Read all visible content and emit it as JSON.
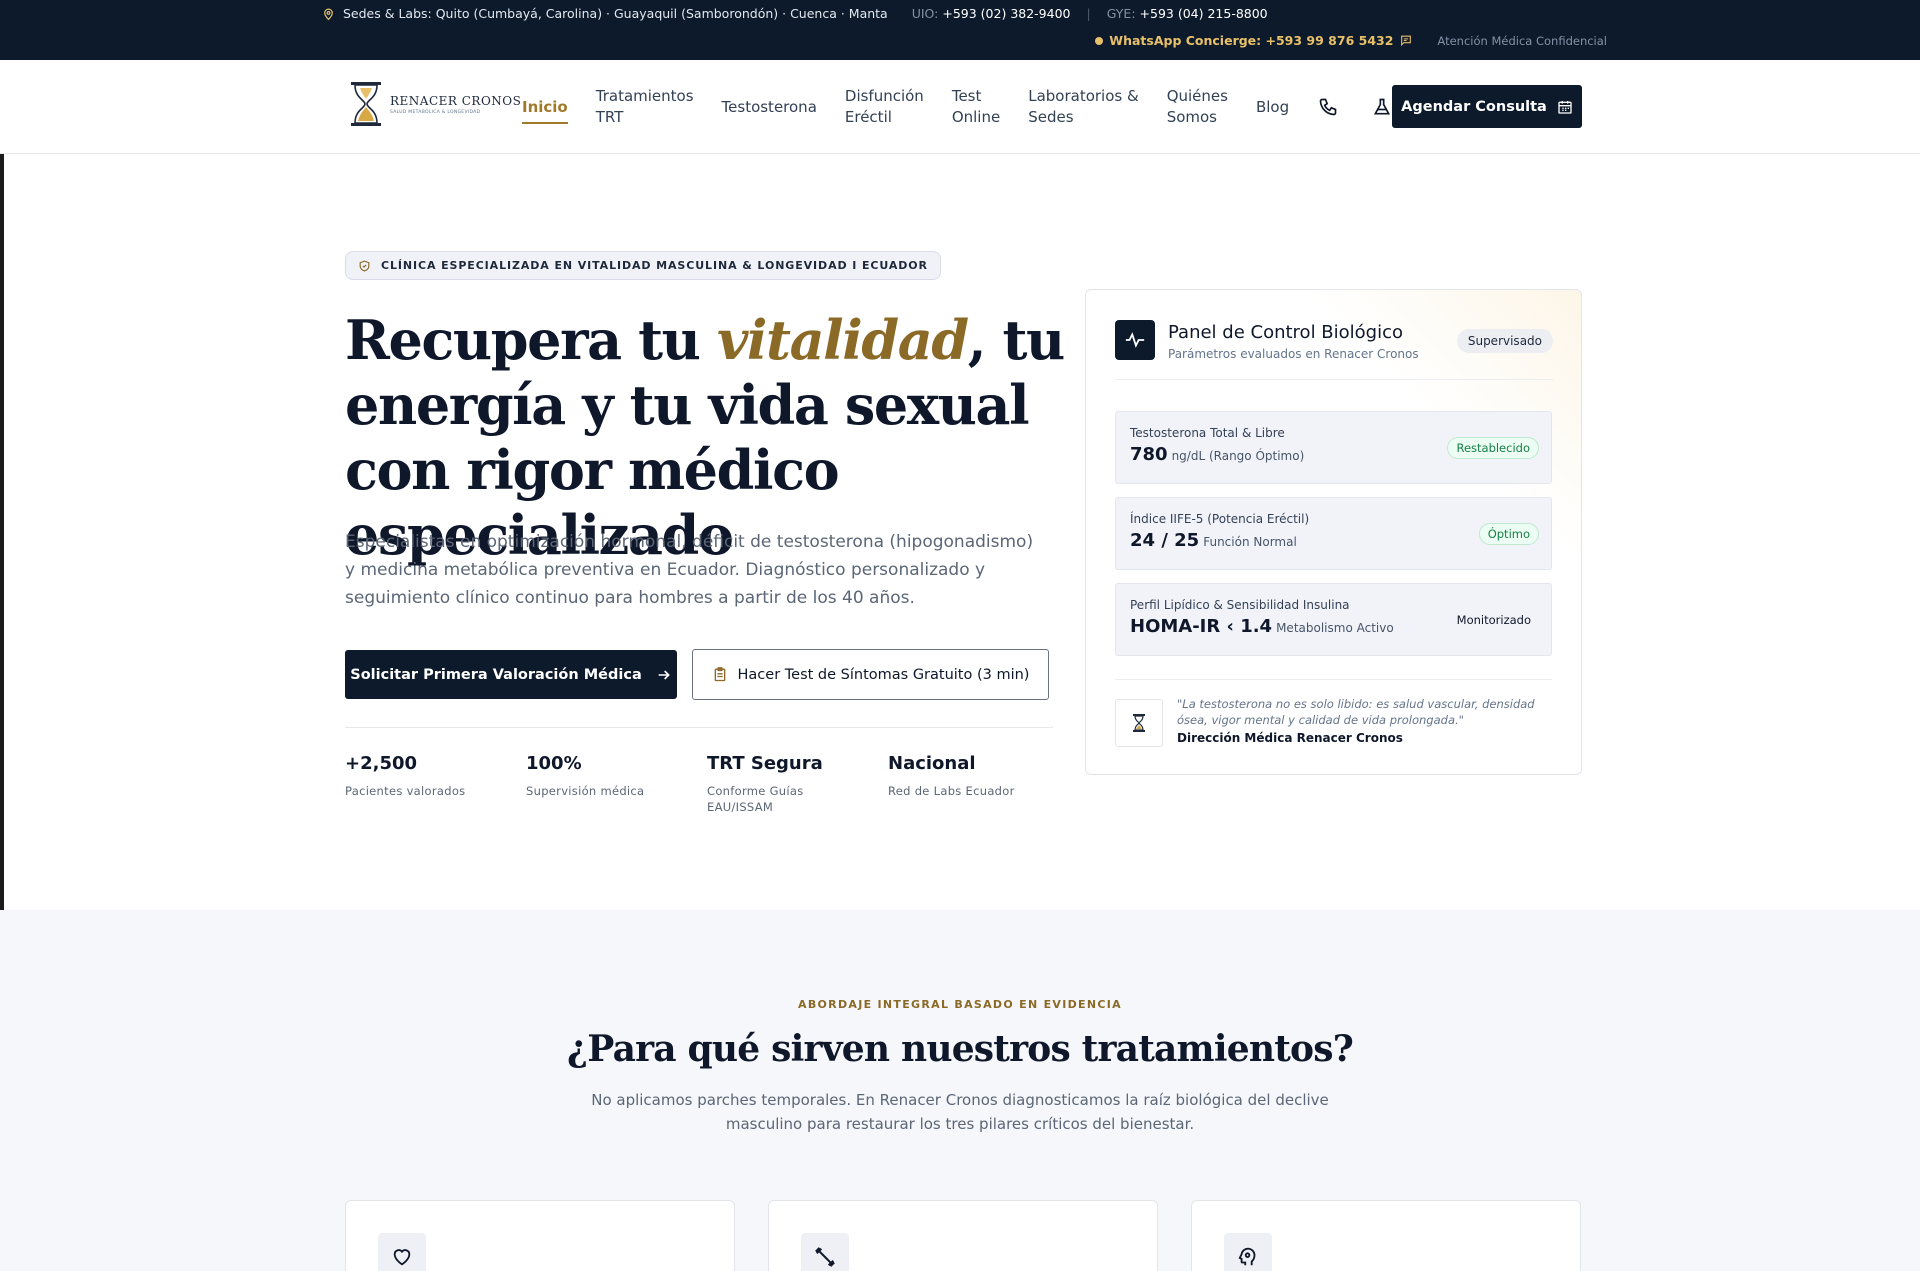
{
  "topbar": {
    "locations": "Sedes & Labs: Quito (Cumbayá, Carolina) · Guayaquil (Samborondón) · Cuenca · Manta",
    "uio_label": "UIO:",
    "uio_phone": "+593 (02) 382-9400",
    "gye_label": "GYE:",
    "gye_phone": "+593 (04) 215-8800",
    "whatsapp": "WhatsApp Concierge: +593 99 876 5432",
    "confidential": "Atención Médica Confidencial"
  },
  "logo": {
    "name": "RENACER CRONOS",
    "tagline": "SALUD METABÓLICA & LONGEVIDAD"
  },
  "nav": {
    "items": [
      {
        "line1": "Inicio",
        "line2": ""
      },
      {
        "line1": "Tratamientos",
        "line2": "TRT"
      },
      {
        "line1": "Testosterona",
        "line2": ""
      },
      {
        "line1": "Disfunción",
        "line2": "Eréctil"
      },
      {
        "line1": "Test",
        "line2": "Online"
      },
      {
        "line1": "Laboratorios &",
        "line2": "Sedes"
      },
      {
        "line1": "Quiénes",
        "line2": "Somos"
      },
      {
        "line1": "Blog",
        "line2": ""
      }
    ],
    "cta": "Agendar Consulta"
  },
  "hero": {
    "badge": "CLÍNICA ESPECIALIZADA EN VITALIDAD MASCULINA & LONGEVIDAD I ECUADOR",
    "title_pre": "Recupera tu ",
    "title_em": "vitalidad",
    "title_post": ", tu energía y tu vida sexual con rigor médico especializado",
    "subtitle": "Especialistas en optimización hormonal, déficit de testosterona (hipogonadismo) y medicina metabólica preventiva en Ecuador. Diagnóstico personalizado y seguimiento clínico continuo para hombres a partir de los 40 años.",
    "primary_cta": "Solicitar Primera Valoración Médica",
    "secondary_cta": "Hacer Test de Síntomas Gratuito (3 min)",
    "stats": [
      {
        "value": "+2,500",
        "label": "Pacientes valorados"
      },
      {
        "value": "100%",
        "label": "Supervisión médica"
      },
      {
        "value": "TRT Segura",
        "label": "Conforme Guías EAU/ISSAM"
      },
      {
        "value": "Nacional",
        "label": "Red de Labs Ecuador"
      }
    ]
  },
  "panel": {
    "title": "Panel de Control Biológico",
    "subtitle": "Parámetros evaluados en Renacer Cronos",
    "status": "Supervisado",
    "metrics": [
      {
        "label": "Testosterona Total & Libre",
        "value": "780",
        "unit": "ng/dL (Rango Óptimo)",
        "badge": "Restablecido"
      },
      {
        "label": "Índice IIFE-5 (Potencia Eréctil)",
        "value": "24 / 25",
        "unit": "Función Normal",
        "badge": "Óptimo"
      },
      {
        "label": "Perfil Lipídico & Sensibilidad Insulina",
        "value": "HOMA-IR ‹ 1.4",
        "unit": "Metabolismo Activo",
        "badge": "Monitorizado"
      }
    ],
    "quote": "\"La testosterona no es solo libido: es salud vascular, densidad ósea, vigor mental y calidad de vida prolongada.\"",
    "quote_author": "Dirección Médica Renacer Cronos"
  },
  "section2": {
    "eyebrow": "ABORDAJE INTEGRAL BASADO EN EVIDENCIA",
    "title": "¿Para qué sirven nuestros tratamientos?",
    "subtitle": "No aplicamos parches temporales. En Renacer Cronos diagnosticamos la raíz biológica del declive masculino para restaurar los tres pilares críticos del bienestar.",
    "card_icons": [
      "heart-icon",
      "dumbbell-icon",
      "brain-gear-icon"
    ]
  },
  "colors": {
    "navy": "#0d1a2b",
    "gold": "#a07a2b",
    "green": "#167f45"
  }
}
